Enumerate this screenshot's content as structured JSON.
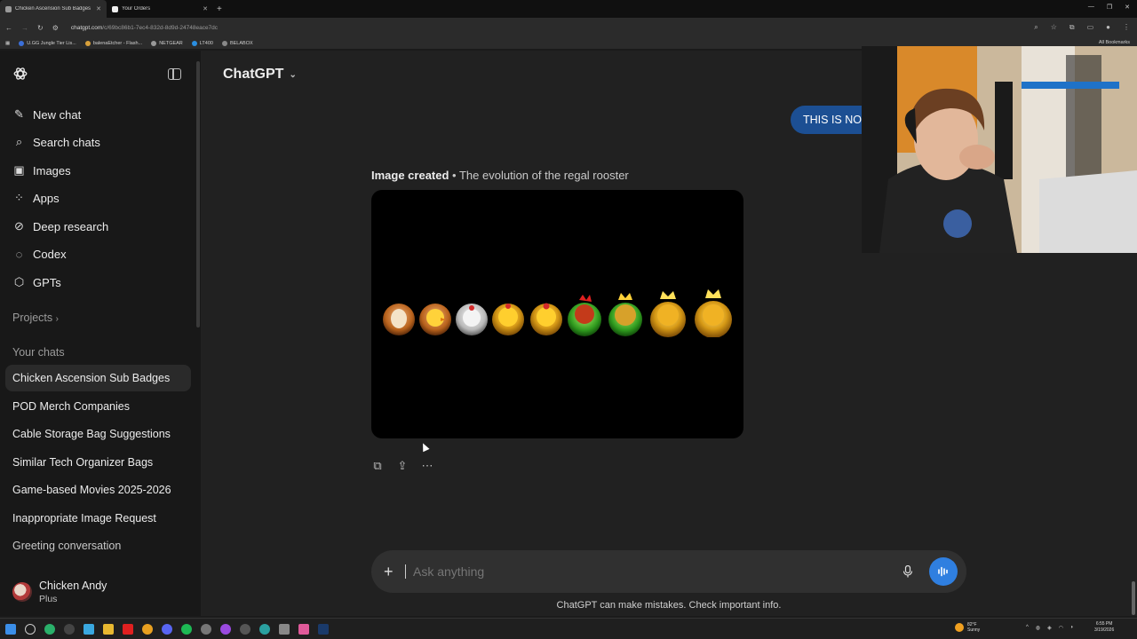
{
  "browser": {
    "tabs": [
      {
        "title": "Chicken Ascension Sub Badges",
        "active": true
      },
      {
        "title": "Your Orders",
        "active": false
      }
    ],
    "url_host": "chatgpt.com",
    "url_path": "/c/69bc86b1-7ec4-832d-8d9d-24748eace7dc",
    "bookmarks": [
      "U.GG Jungle Tier Lis...",
      "balenaEtcher - Flash...",
      "NETGEAR",
      "LT400",
      "BELABOX"
    ],
    "all_bookmarks": "All Bookmarks"
  },
  "sidebar": {
    "nav": [
      {
        "label": "New chat",
        "icon": "edit-icon"
      },
      {
        "label": "Search chats",
        "icon": "search-icon"
      },
      {
        "label": "Images",
        "icon": "image-icon"
      },
      {
        "label": "Apps",
        "icon": "apps-icon"
      },
      {
        "label": "Deep research",
        "icon": "telescope-icon"
      },
      {
        "label": "Codex",
        "icon": "codex-icon"
      },
      {
        "label": "GPTs",
        "icon": "cube-icon"
      }
    ],
    "projects_label": "Projects",
    "your_chats_label": "Your chats",
    "chats": [
      "Chicken Ascension Sub Badges",
      "POD Merch Companies",
      "Cable Storage Bag Suggestions",
      "Similar Tech Organizer Bags",
      "Game-based Movies 2025-2026",
      "Inappropriate Image Request",
      "Greeting conversation"
    ],
    "user": {
      "name": "Chicken Andy",
      "plan": "Plus"
    }
  },
  "main": {
    "model_label": "ChatGPT",
    "user_message": "THIS IS NO",
    "image_caption_bold": "Image created",
    "image_caption_sep": " • ",
    "image_caption_title": "The evolution of the regal rooster",
    "composer_placeholder": "Ask anything",
    "disclaimer": "ChatGPT can make mistakes. Check important info."
  },
  "taskbar": {
    "weather_temp": "82°F",
    "weather_desc": "Sunny",
    "time": "6:55 PM",
    "date": "3/19/2026"
  },
  "colors": {
    "accent_blue": "#2f7fe0",
    "user_bubble": "#1c4f93",
    "main_bg": "#212121",
    "sidebar_bg": "#181818"
  }
}
